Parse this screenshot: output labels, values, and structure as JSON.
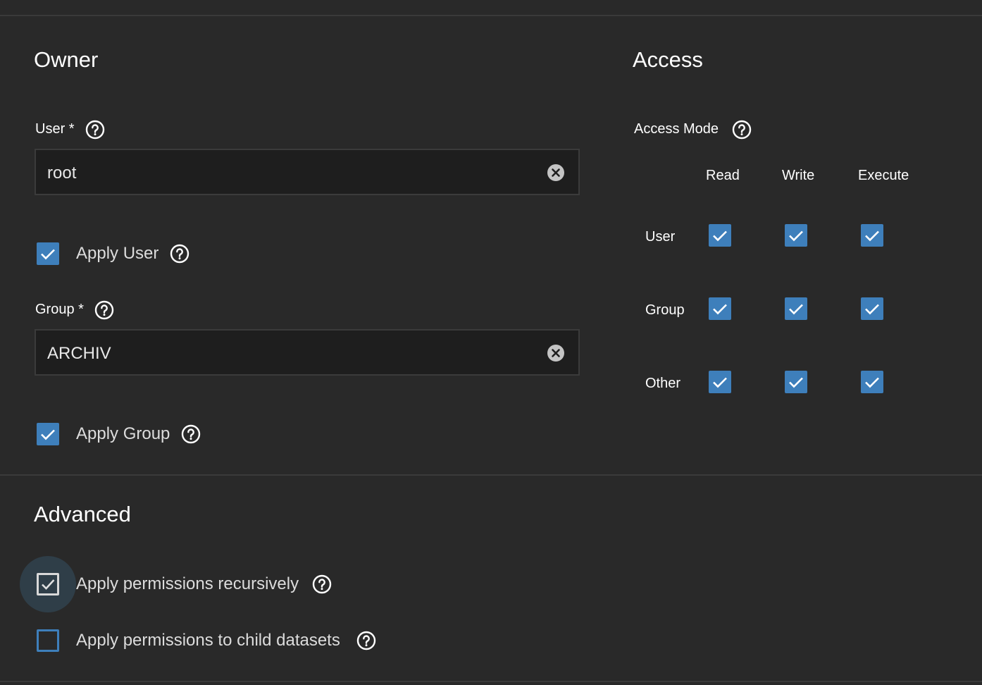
{
  "owner": {
    "title": "Owner",
    "user_label": "User *",
    "user_value": "root",
    "apply_user_label": "Apply User",
    "apply_user_checked": true,
    "group_label": "Group *",
    "group_value": "ARCHIV",
    "apply_group_label": "Apply Group",
    "apply_group_checked": true
  },
  "access": {
    "title": "Access",
    "mode_label": "Access Mode",
    "columns": [
      "Read",
      "Write",
      "Execute"
    ],
    "rows": [
      {
        "label": "User",
        "read": true,
        "write": true,
        "execute": true
      },
      {
        "label": "Group",
        "read": true,
        "write": true,
        "execute": true
      },
      {
        "label": "Other",
        "read": true,
        "write": true,
        "execute": true
      }
    ]
  },
  "advanced": {
    "title": "Advanced",
    "recursive_label": "Apply permissions recursively",
    "recursive_checked": true,
    "child_label": "Apply permissions to child datasets",
    "child_checked": false
  },
  "colors": {
    "background": "#292929",
    "checkbox_accent": "#3e7fbb",
    "input_background": "#1e1e1e"
  },
  "icons": [
    "help-icon",
    "clear-icon",
    "checkmark-icon"
  ]
}
